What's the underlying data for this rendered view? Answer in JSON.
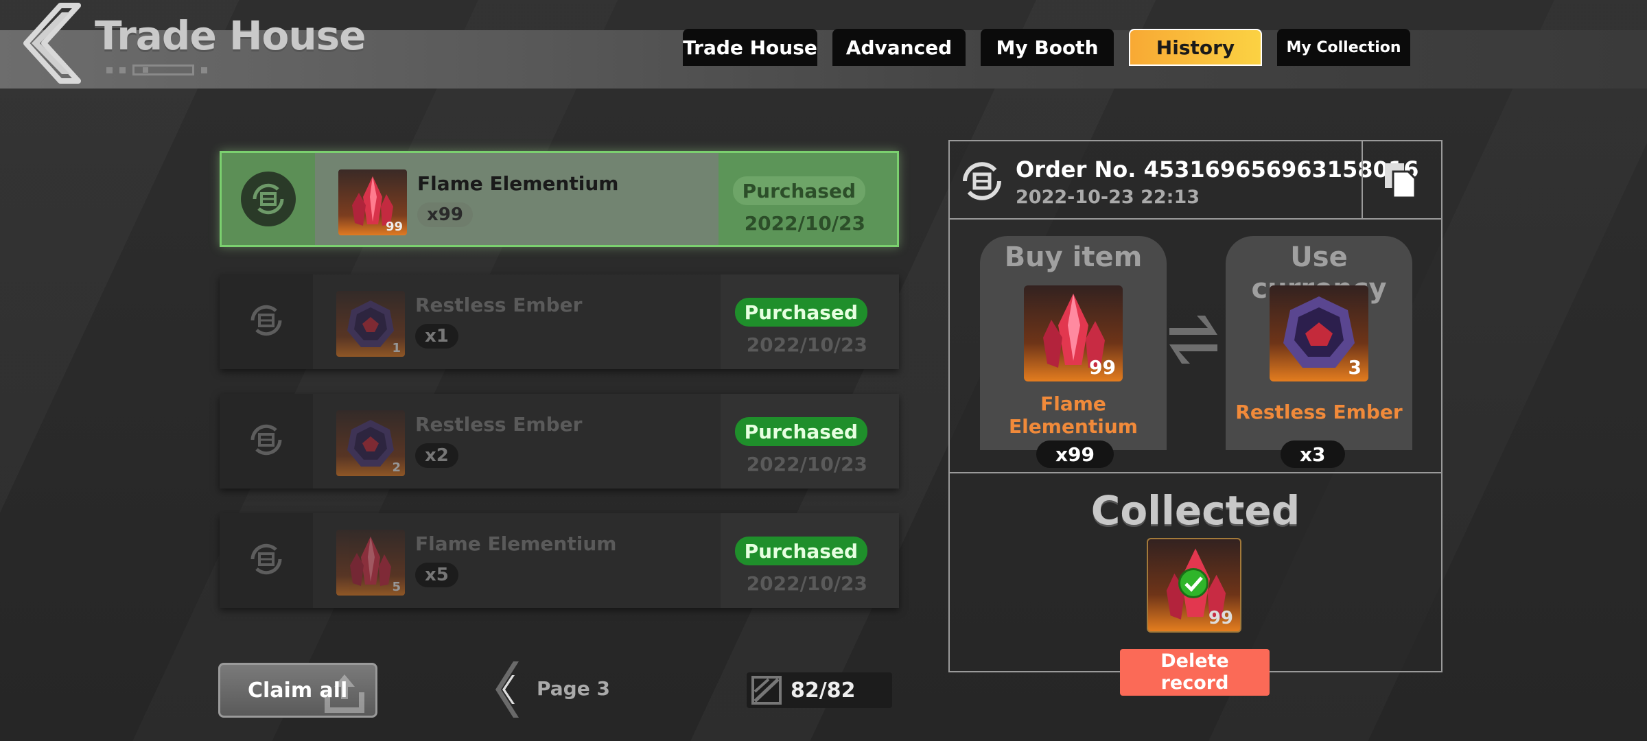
{
  "header": {
    "title": "Trade House",
    "tabs": [
      {
        "label": "Trade House",
        "active": false
      },
      {
        "label": "Advanced",
        "active": false
      },
      {
        "label": "My Booth",
        "active": false
      },
      {
        "label": "History",
        "active": true
      },
      {
        "label": "My Collection",
        "active": false
      }
    ]
  },
  "history": {
    "items": [
      {
        "name": "Flame Elementium",
        "qty": "x99",
        "thumb_count": "99",
        "status": "Purchased",
        "date": "2022/10/23",
        "selected": true,
        "icon": "flame-elementium-icon"
      },
      {
        "name": "Restless Ember",
        "qty": "x1",
        "thumb_count": "1",
        "status": "Purchased",
        "date": "2022/10/23",
        "selected": false,
        "icon": "restless-ember-icon"
      },
      {
        "name": "Restless Ember",
        "qty": "x2",
        "thumb_count": "2",
        "status": "Purchased",
        "date": "2022/10/23",
        "selected": false,
        "icon": "restless-ember-icon"
      },
      {
        "name": "Flame Elementium",
        "qty": "x5",
        "thumb_count": "5",
        "status": "Purchased",
        "date": "2022/10/23",
        "selected": false,
        "icon": "flame-elementium-icon"
      }
    ]
  },
  "footer": {
    "claim_all": "Claim all",
    "page": "Page 3",
    "count": "82/82"
  },
  "detail": {
    "order_no": "Order No. 453169656963158016",
    "order_time": "2022-10-23 22:13",
    "buy": {
      "title": "Buy item",
      "name_line1": "Flame",
      "name_line2": "Elementium",
      "thumb_count": "99",
      "qty": "x99"
    },
    "currency": {
      "title": "Use currency",
      "name": "Restless Ember",
      "thumb_count": "3",
      "qty": "x3"
    },
    "collected_label": "Collected",
    "collected_count": "99",
    "delete_line1": "Delete",
    "delete_line2": "record"
  },
  "colors": {
    "tab_active": "#fbc53c",
    "purchased": "#1f8f2b",
    "item_name_orange": "#f18a3a",
    "delete": "#fb6a57"
  }
}
